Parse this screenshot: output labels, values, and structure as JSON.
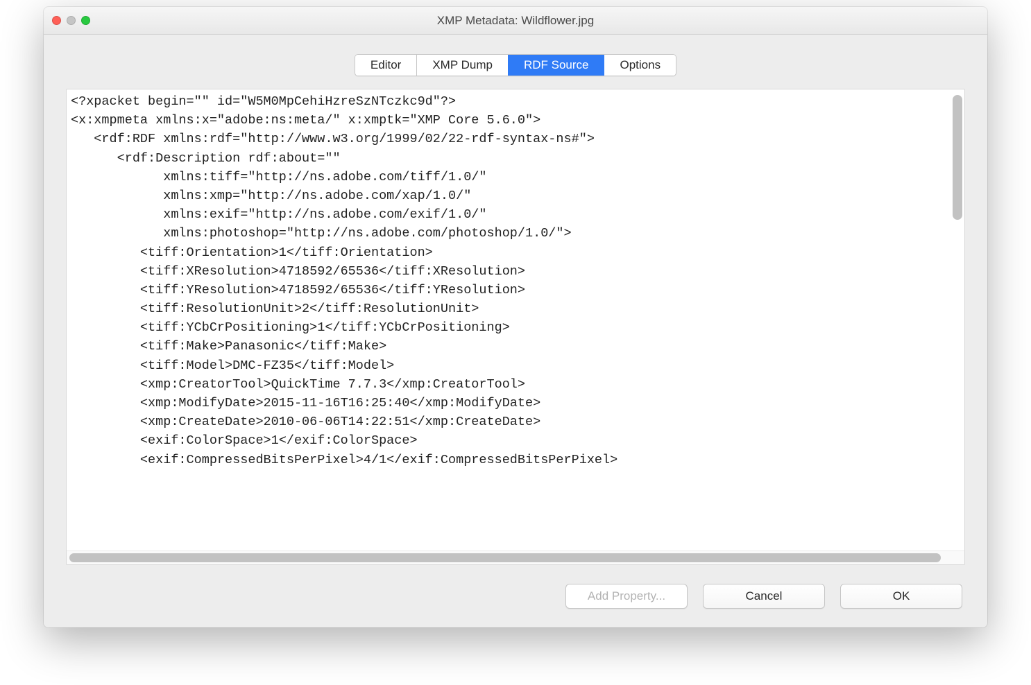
{
  "window": {
    "title": "XMP Metadata: Wildflower.jpg"
  },
  "tabs": {
    "items": [
      "Editor",
      "XMP Dump",
      "RDF Source",
      "Options"
    ],
    "active_index": 2
  },
  "source": {
    "lines": [
      "<?xpacket begin=\"\" id=\"W5M0MpCehiHzreSzNTczkc9d\"?>",
      "<x:xmpmeta xmlns:x=\"adobe:ns:meta/\" x:xmptk=\"XMP Core 5.6.0\">",
      "   <rdf:RDF xmlns:rdf=\"http://www.w3.org/1999/02/22-rdf-syntax-ns#\">",
      "      <rdf:Description rdf:about=\"\"",
      "            xmlns:tiff=\"http://ns.adobe.com/tiff/1.0/\"",
      "            xmlns:xmp=\"http://ns.adobe.com/xap/1.0/\"",
      "            xmlns:exif=\"http://ns.adobe.com/exif/1.0/\"",
      "            xmlns:photoshop=\"http://ns.adobe.com/photoshop/1.0/\">",
      "         <tiff:Orientation>1</tiff:Orientation>",
      "         <tiff:XResolution>4718592/65536</tiff:XResolution>",
      "         <tiff:YResolution>4718592/65536</tiff:YResolution>",
      "         <tiff:ResolutionUnit>2</tiff:ResolutionUnit>",
      "         <tiff:YCbCrPositioning>1</tiff:YCbCrPositioning>",
      "         <tiff:Make>Panasonic</tiff:Make>",
      "         <tiff:Model>DMC-FZ35</tiff:Model>",
      "         <xmp:CreatorTool>QuickTime 7.7.3</xmp:CreatorTool>",
      "         <xmp:ModifyDate>2015-11-16T16:25:40</xmp:ModifyDate>",
      "         <xmp:CreateDate>2010-06-06T14:22:51</xmp:CreateDate>",
      "         <exif:ColorSpace>1</exif:ColorSpace>",
      "         <exif:CompressedBitsPerPixel>4/1</exif:CompressedBitsPerPixel>"
    ]
  },
  "buttons": {
    "add_property": "Add Property...",
    "cancel": "Cancel",
    "ok": "OK"
  }
}
